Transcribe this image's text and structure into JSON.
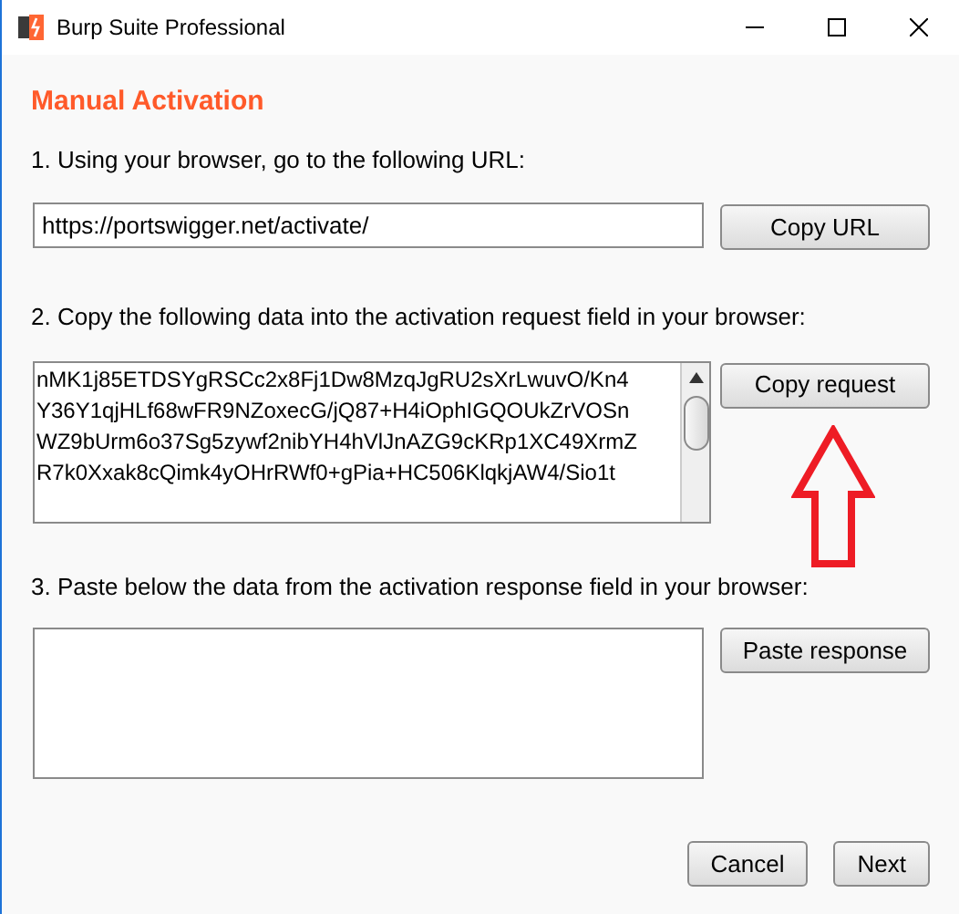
{
  "window": {
    "title": "Burp Suite Professional"
  },
  "heading": "Manual Activation",
  "step1": {
    "label": "1. Using your browser, go to the following URL:",
    "url": "https://portswigger.net/activate/",
    "button": "Copy URL"
  },
  "step2": {
    "label": "2. Copy the following data into the activation request field in your browser:",
    "lines": [
      "nMK1j85ETDSYgRSCc2x8Fj1Dw8MzqJgRU2sXrLwuvO/Kn4",
      "Y36Y1qjHLf68wFR9NZoxecG/jQ87+H4iOphIGQOUkZrVOSn",
      "WZ9bUrm6o37Sg5zywf2nibYH4hVlJnAZG9cKRp1XC49XrmZ",
      "R7k0Xxak8cQimk4yOHrRWf0+gPia+HC506KlqkjAW4/Sio1t"
    ],
    "button": "Copy request"
  },
  "step3": {
    "label": "3. Paste below the data from the activation response field in your browser:",
    "button": "Paste response"
  },
  "buttons": [
    "Cancel",
    "Next"
  ]
}
